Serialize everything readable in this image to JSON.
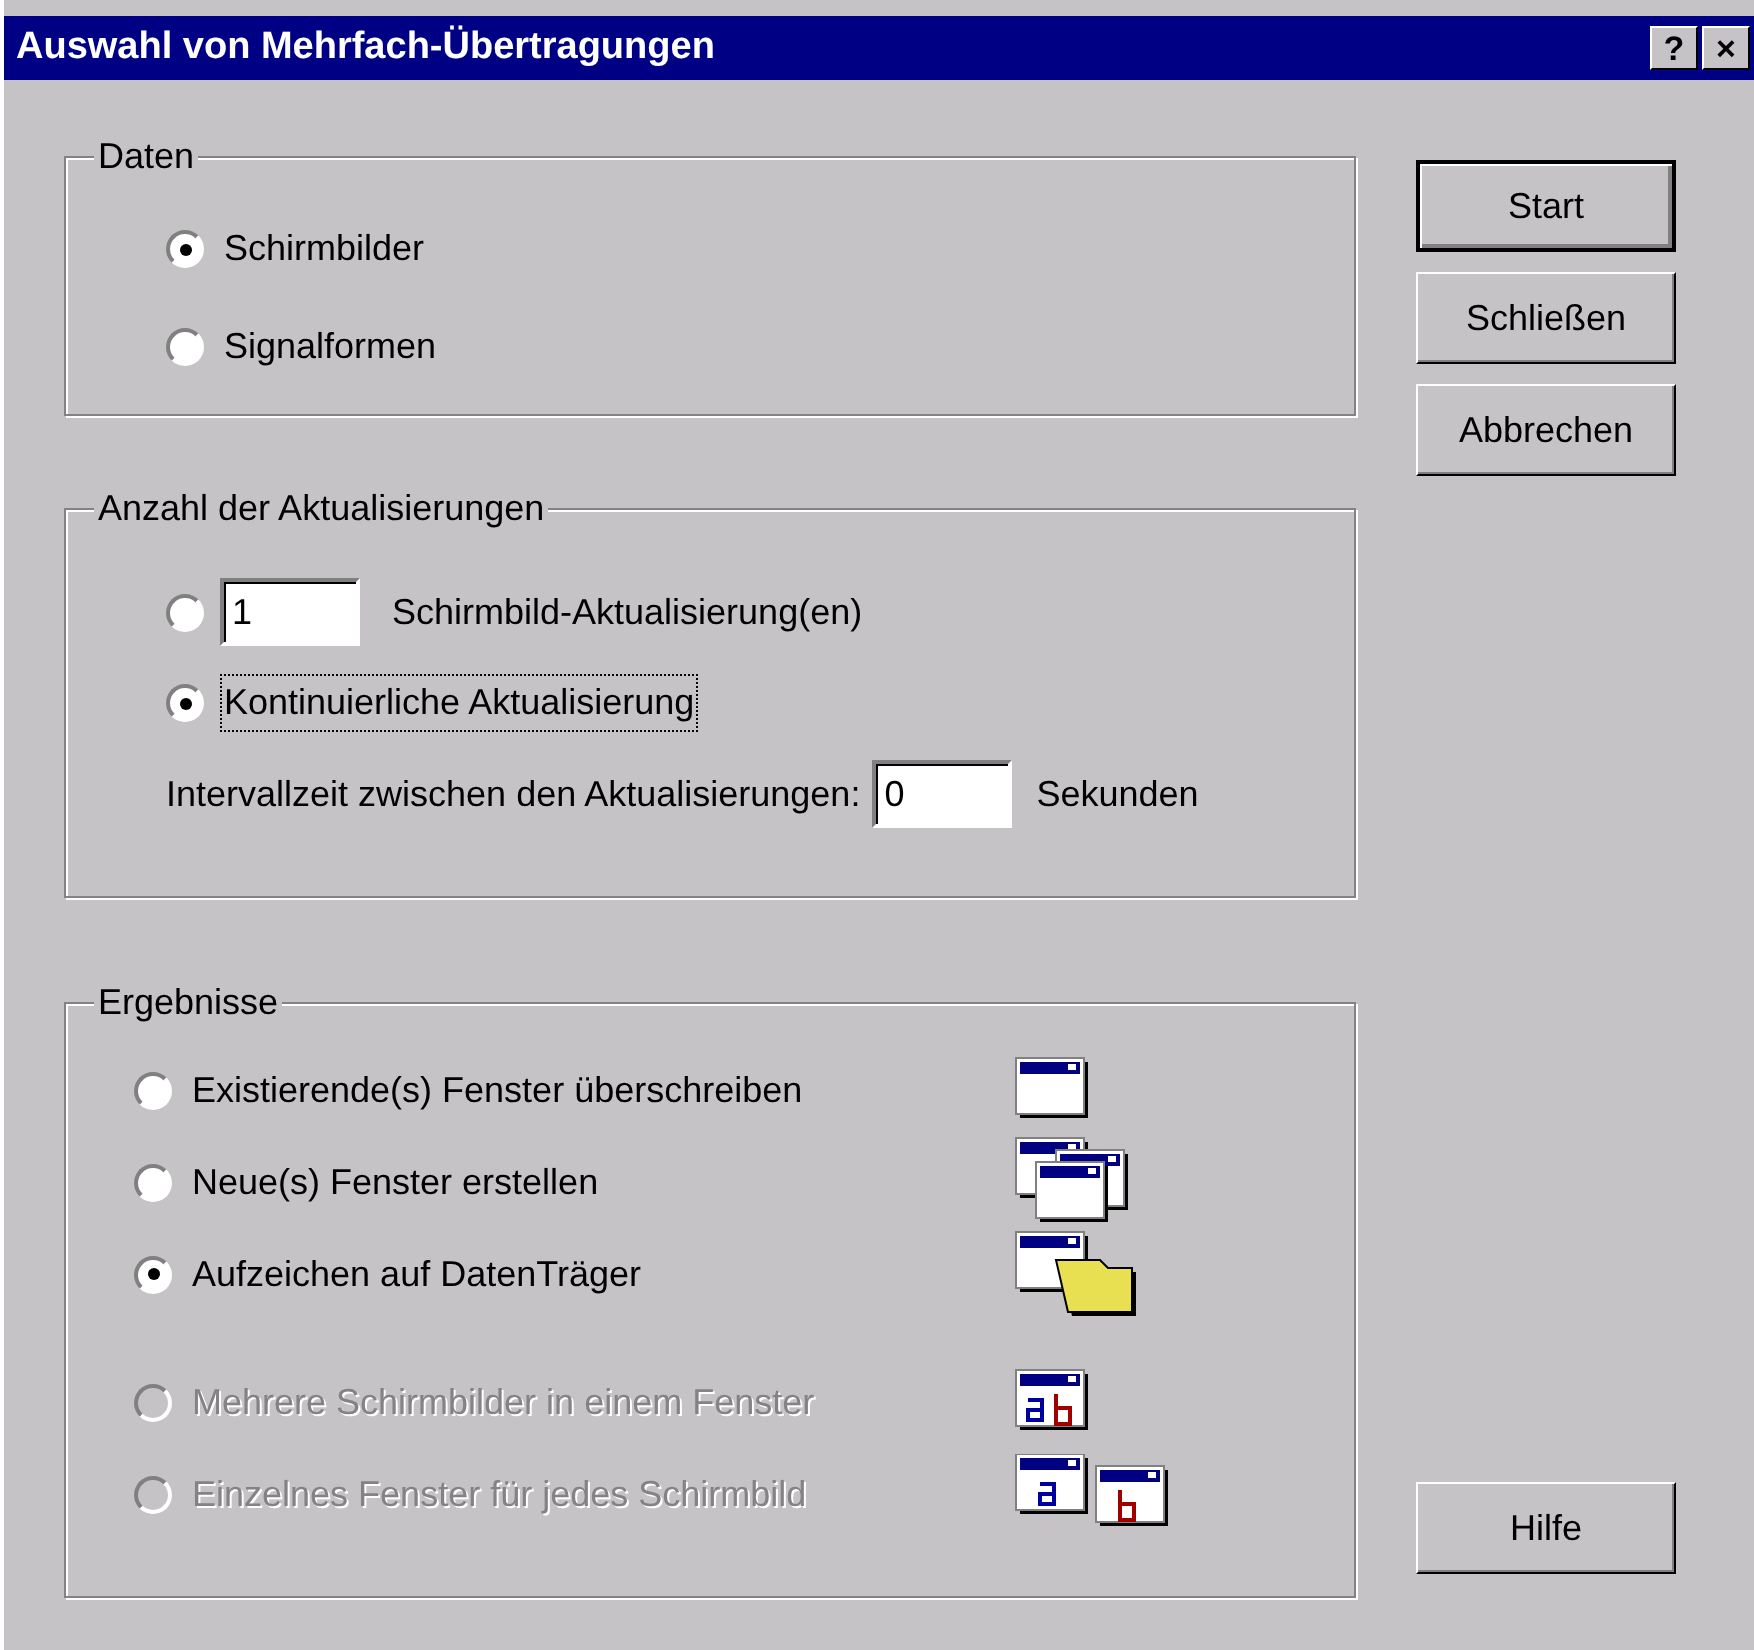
{
  "window": {
    "title": "Auswahl von Mehrfach-Übertragungen",
    "title_buttons": [
      "?",
      "×"
    ]
  },
  "data_group": {
    "title": "Daten",
    "options": [
      {
        "label": "Schirmbilder",
        "selected": true
      },
      {
        "label": "Signalformen",
        "selected": false
      }
    ]
  },
  "updates_group": {
    "title": "Anzahl der Aktualisierungen",
    "options": [
      {
        "kind": "count",
        "value": "1",
        "unit": "Schirmbild-Aktualisierung(en)",
        "selected": false,
        "focused": false
      },
      {
        "kind": "plain",
        "label": "Kontinuierliche Aktualisierung",
        "selected": true,
        "focused": true
      }
    ],
    "interval": {
      "label": "Intervallzeit zwischen den Aktualisierungen:",
      "value": "0",
      "unit": "Sekunden"
    }
  },
  "results_group": {
    "title": "Ergebnisse",
    "options": [
      {
        "kind": "single",
        "label": "Existierende(s) Fenster überschreiben",
        "selected": false,
        "disabled": false
      },
      {
        "kind": "multiple",
        "label": "Neue(s) Fenster erstellen",
        "selected": false,
        "disabled": false
      },
      {
        "kind": "folder",
        "label": "Aufzeichen auf DatenTräger",
        "selected": true,
        "disabled": false
      },
      {
        "kind": "combined",
        "label": "Mehrere Schirmbilder in einem Fenster",
        "selected": false,
        "disabled": true
      },
      {
        "kind": "separate",
        "label": "Einzelnes Fenster für jedes Schirmbild",
        "selected": false,
        "disabled": true
      }
    ]
  },
  "buttons": [
    {
      "label": "Start",
      "default": true
    },
    {
      "label": "Schließen",
      "default": false
    },
    {
      "label": "Abbrechen",
      "default": false
    }
  ],
  "help_button": {
    "label": "Hilfe"
  }
}
